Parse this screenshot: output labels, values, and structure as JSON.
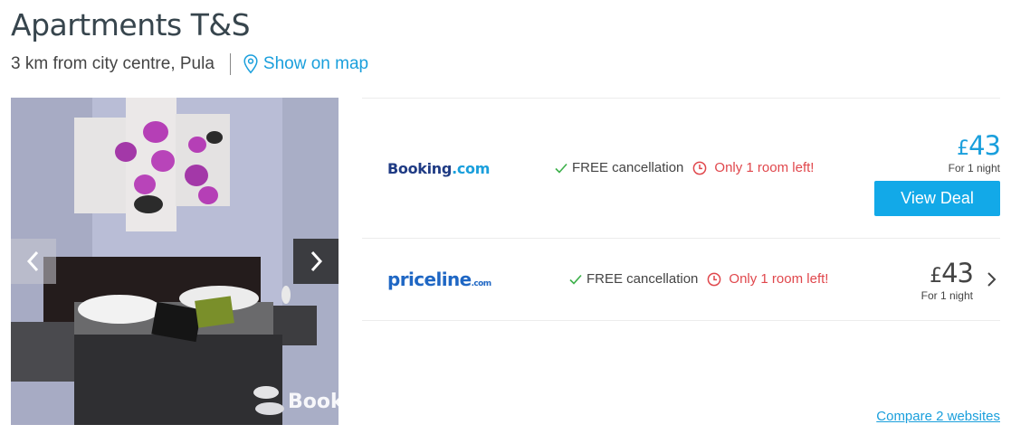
{
  "header": {
    "title": "Apartments T&S",
    "location": "3 km from city centre, Pula",
    "map_link": "Show on map"
  },
  "gallery": {
    "watermark": "Booki",
    "prev_icon": "chevron-left-icon",
    "next_icon": "chevron-right-icon"
  },
  "deals": [
    {
      "provider": "Booking.com",
      "logo_main": "Booking",
      "logo_suffix": ".com",
      "free_cancellation": "FREE cancellation",
      "rooms_left": "Only 1 room left!",
      "currency": "£",
      "price": "43",
      "per": "For 1 night",
      "cta": "View Deal"
    },
    {
      "provider": "priceline.com",
      "logo_main": "priceline",
      "logo_suffix": ".com",
      "free_cancellation": "FREE cancellation",
      "rooms_left": "Only 1 room left!",
      "currency": "£",
      "price": "43",
      "per": "For 1 night"
    }
  ],
  "compare_link": "Compare 2 websites",
  "colors": {
    "accent": "#1a9fdc",
    "button": "#12a9e8",
    "warning": "#e0474c",
    "check": "#3cb04a",
    "title": "#37454d"
  }
}
